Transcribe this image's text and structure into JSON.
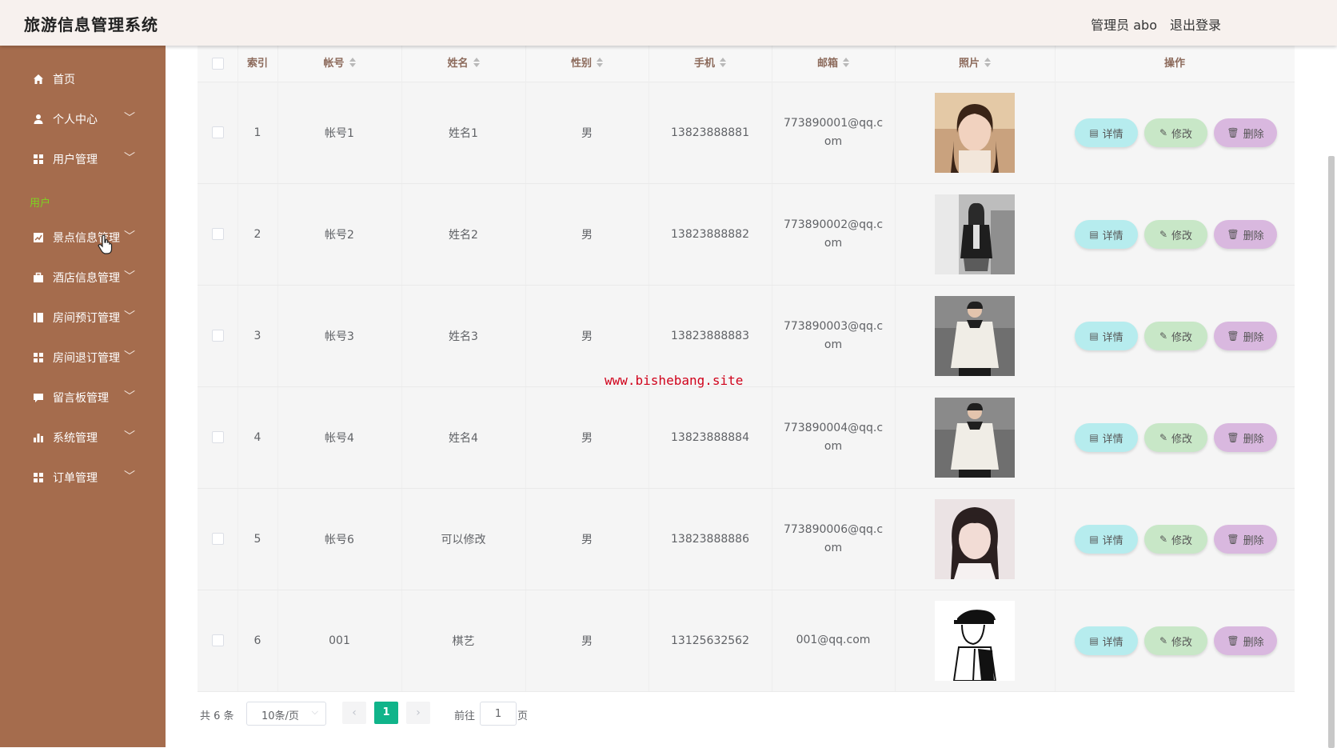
{
  "header": {
    "title": "旅游信息管理系统",
    "admin_label": "管理员 abo",
    "logout_label": "退出登录"
  },
  "sidebar": {
    "items": [
      {
        "label": "首页",
        "icon": "home-icon",
        "chevron": false
      },
      {
        "label": "个人中心",
        "icon": "user-icon",
        "chevron": true
      },
      {
        "label": "用户管理",
        "icon": "grid-icon",
        "chevron": true
      },
      {
        "label": "景点信息管理",
        "icon": "chart-icon",
        "chevron": true
      },
      {
        "label": "酒店信息管理",
        "icon": "briefcase-icon",
        "chevron": true
      },
      {
        "label": "房间预订管理",
        "icon": "book-icon",
        "chevron": true
      },
      {
        "label": "房间退订管理",
        "icon": "grid-icon",
        "chevron": true
      },
      {
        "label": "留言板管理",
        "icon": "message-icon",
        "chevron": true
      },
      {
        "label": "系统管理",
        "icon": "bar-chart-icon",
        "chevron": true
      },
      {
        "label": "订单管理",
        "icon": "grid-icon",
        "chevron": true
      }
    ],
    "sub_item": "用户",
    "chevron_glyph": "﹀"
  },
  "table": {
    "headers": [
      "索引",
      "帐号",
      "姓名",
      "性别",
      "手机",
      "邮箱",
      "照片",
      "操作"
    ],
    "rows": [
      {
        "index": "1",
        "account": "帐号1",
        "name": "姓名1",
        "gender": "男",
        "phone": "13823888881",
        "email": "773890001@qq.com",
        "photo": "young-woman-portrait"
      },
      {
        "index": "2",
        "account": "帐号2",
        "name": "姓名2",
        "gender": "男",
        "phone": "13823888882",
        "email": "773890002@qq.com",
        "photo": "woman-in-black-jacket"
      },
      {
        "index": "3",
        "account": "帐号3",
        "name": "姓名3",
        "gender": "男",
        "phone": "13823888883",
        "email": "773890003@qq.com",
        "photo": "man-in-white-sweater"
      },
      {
        "index": "4",
        "account": "帐号4",
        "name": "姓名4",
        "gender": "男",
        "phone": "13823888884",
        "email": "773890004@qq.com",
        "photo": "man-in-white-sweater"
      },
      {
        "index": "5",
        "account": "帐号6",
        "name": "可以修改",
        "gender": "男",
        "phone": "13823888886",
        "email": "773890006@qq.com",
        "photo": "girl-portrait"
      },
      {
        "index": "6",
        "account": "001",
        "name": "棋艺",
        "gender": "男",
        "phone": "13125632562",
        "email": "001@qq.com",
        "photo": "cartoon-boy-sketch"
      }
    ],
    "actions": {
      "detail": "详情",
      "edit": "修改",
      "delete": "删除"
    }
  },
  "watermark": "www.bishebang.site",
  "pagination": {
    "total": "共 6 条",
    "page_size": "10条/页",
    "current_page": "1",
    "goto_label": "前往",
    "goto_value": "1",
    "page_unit": "页",
    "prev": "‹",
    "next": "›"
  },
  "colors": {
    "sidebar": "#a56c4d",
    "header": "#f7f1ee",
    "accent": "#10b48a",
    "detail_btn": "#b6ecee",
    "edit_btn": "#c8e7c7",
    "delete_btn": "#d9b8df",
    "watermark": "#d0021b"
  }
}
